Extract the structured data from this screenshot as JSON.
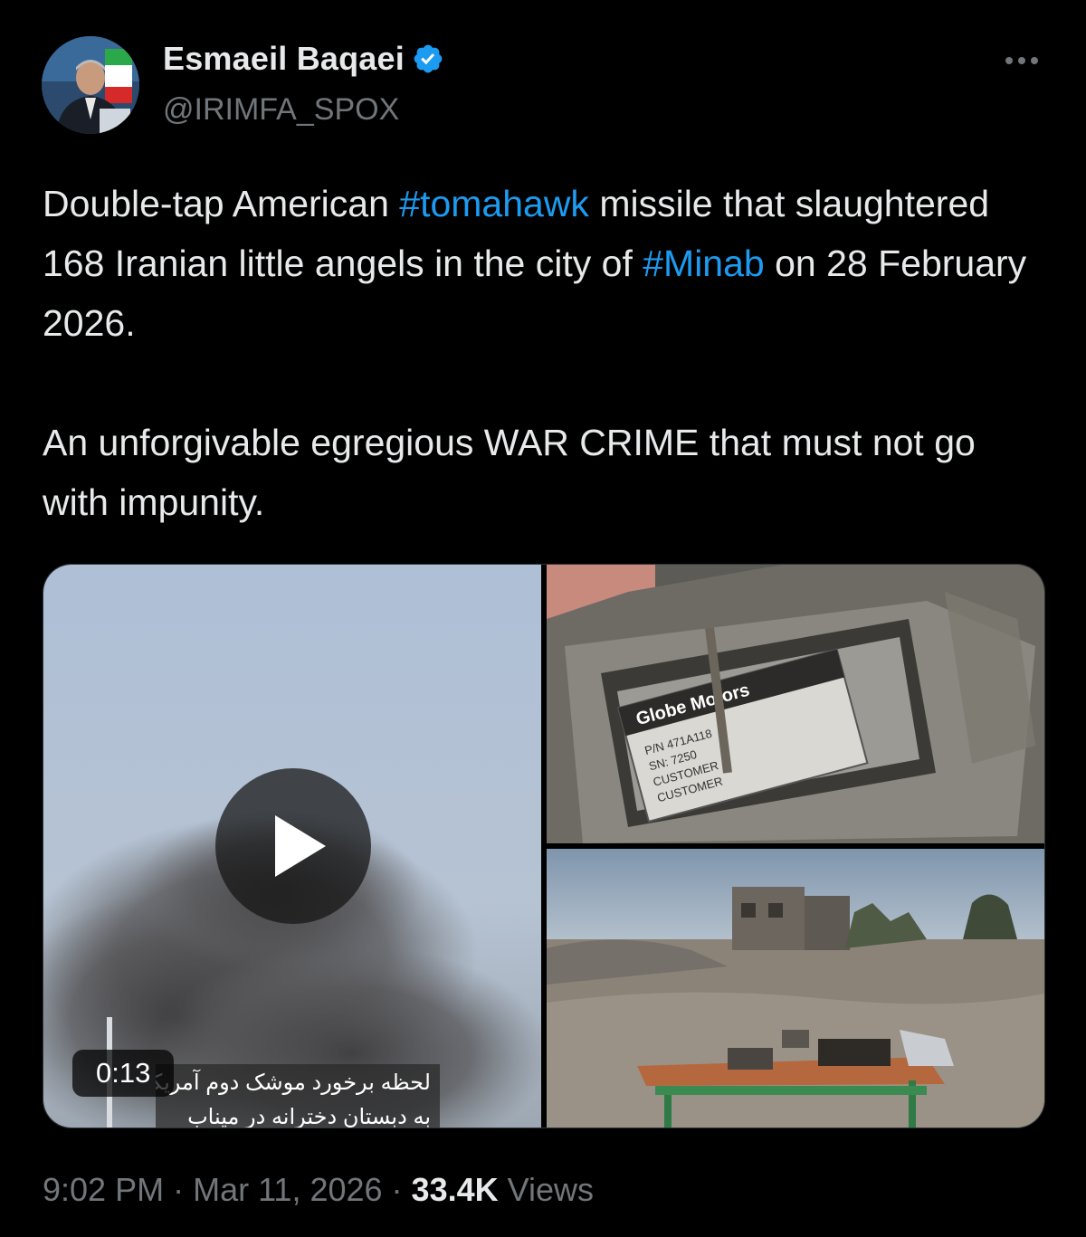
{
  "author": {
    "name": "Esmaeil Baqaei",
    "handle": "@IRIMFA_SPOX",
    "verified_icon": "verified-badge-icon",
    "verified_color": "#1d9bf0"
  },
  "tweet": {
    "p1_part1": "Double-tap American ",
    "hashtag1": "#tomahawk",
    "p1_part2": " missile that slaughtered 168 Iranian little angels in the city of ",
    "hashtag2": "#Minab",
    "p1_part3": " on 28 February 2026.",
    "p2": "An unforgivable egregious WAR  CRIME that must not go with impunity."
  },
  "media": {
    "video_duration": "0:13",
    "video_caption_line1": "لحظه برخورد موشک دوم آمریکا",
    "video_caption_line2": "به دبستان دخترانه در میناب",
    "play_icon": "play-icon",
    "label_brand": "Globe Motors",
    "label_lines": [
      "P/N 471A118",
      "SN: 7250",
      "CUSTOMER",
      "CUSTOMER"
    ]
  },
  "meta": {
    "time": "9:02 PM",
    "sep1": " · ",
    "date": "Mar 11, 2026",
    "sep2": " · ",
    "views_count": "33.4K",
    "views_label": " Views"
  },
  "colors": {
    "background": "#000000",
    "text": "#e7e9ea",
    "secondary": "#71767b",
    "link": "#1d9bf0"
  }
}
